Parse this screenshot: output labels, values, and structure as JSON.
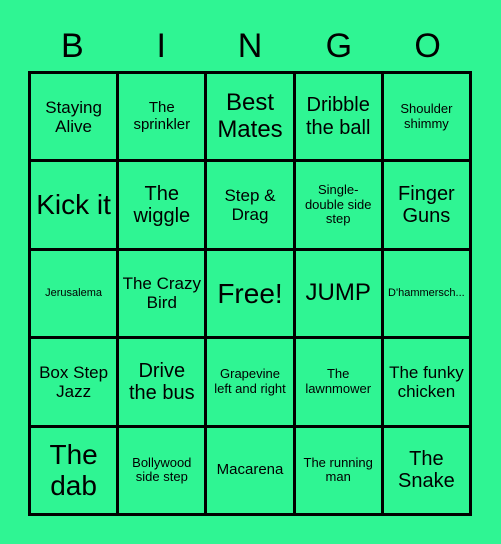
{
  "card": {
    "title": "BINGO",
    "header_letters": [
      "B",
      "I",
      "N",
      "G",
      "O"
    ],
    "colors": {
      "background": "#2ff593",
      "cell_background": "#2ff593",
      "border": "#000000",
      "text": "#000000"
    },
    "grid_size": "5x5",
    "free_space": "Free!",
    "rows": [
      [
        {
          "label": "Staying Alive",
          "size": "m"
        },
        {
          "label": "The sprinkler",
          "size": "s"
        },
        {
          "label": "Best Mates",
          "size": "xl"
        },
        {
          "label": "Dribble the ball",
          "size": "l"
        },
        {
          "label": "Shoulder shimmy",
          "size": "xs"
        }
      ],
      [
        {
          "label": "Kick it",
          "size": "xxl"
        },
        {
          "label": "The wiggle",
          "size": "l"
        },
        {
          "label": "Step & Drag",
          "size": "m"
        },
        {
          "label": "Single-double side step",
          "size": "xs"
        },
        {
          "label": "Finger Guns",
          "size": "l"
        }
      ],
      [
        {
          "label": "Jerusalema",
          "size": "xxs"
        },
        {
          "label": "The Crazy Bird",
          "size": "m"
        },
        {
          "label": "Free!",
          "size": "xxl"
        },
        {
          "label": "JUMP",
          "size": "xl"
        },
        {
          "label": "D'hammersch...",
          "size": "xxs",
          "truncated": true
        }
      ],
      [
        {
          "label": "Box Step Jazz",
          "size": "m"
        },
        {
          "label": "Drive the bus",
          "size": "l"
        },
        {
          "label": "Grapevine left and right",
          "size": "xs"
        },
        {
          "label": "The lawnmower",
          "size": "xs"
        },
        {
          "label": "The funky chicken",
          "size": "m"
        }
      ],
      [
        {
          "label": "The dab",
          "size": "xxl"
        },
        {
          "label": "Bollywood side step",
          "size": "xs"
        },
        {
          "label": "Macarena",
          "size": "s"
        },
        {
          "label": "The running man",
          "size": "xs"
        },
        {
          "label": "The Snake",
          "size": "l"
        }
      ]
    ]
  }
}
